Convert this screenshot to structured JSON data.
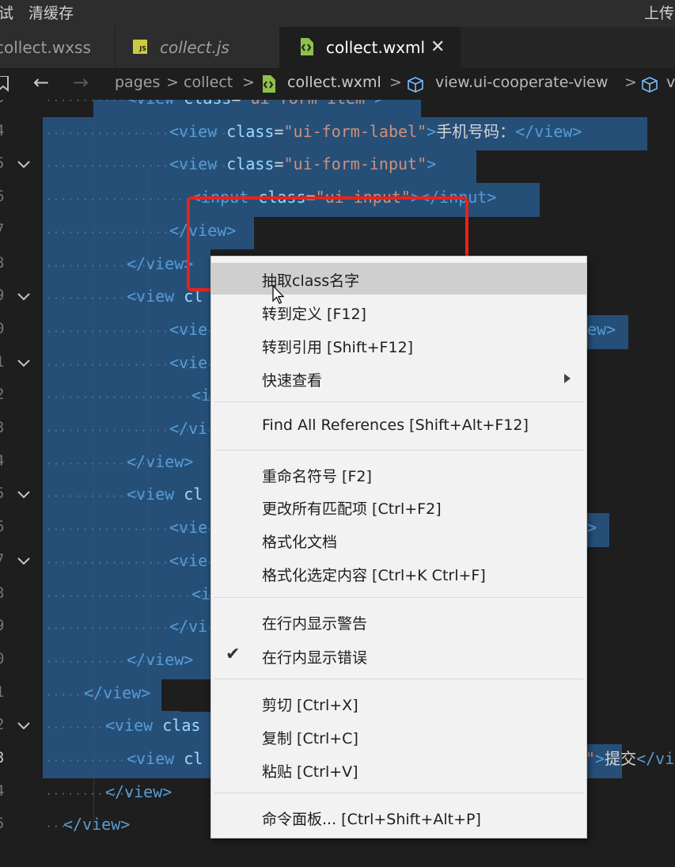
{
  "topbar": {
    "left_items": [
      "试",
      "清缓存"
    ],
    "right_item": "上传"
  },
  "tabs": [
    {
      "label": "collect.wxss"
    },
    {
      "label": "collect.js",
      "badge": "JS"
    },
    {
      "label": "collect.wxml",
      "close": "✕"
    }
  ],
  "breadcrumbs": {
    "items": [
      "pages",
      "collect",
      "collect.wxml",
      "view.ui-cooperate-view",
      "v"
    ],
    "separator": ">"
  },
  "gutter": {
    "line_numbers": [
      "3",
      "4",
      "5",
      "6",
      "7",
      "8",
      "9",
      "0",
      "1",
      "2",
      "3",
      "4",
      "5",
      "6",
      "7",
      "8",
      "9",
      "0",
      "1",
      "2",
      "3",
      "4",
      "5"
    ],
    "current_line": "3"
  },
  "code": [
    {
      "parts": [
        [
          "t",
          "<view "
        ],
        [
          "a",
          "class"
        ],
        [
          "x",
          "="
        ],
        [
          "s",
          "\"ui-form-item\""
        ],
        [
          "t",
          ">"
        ]
      ]
    },
    {
      "parts": [
        [
          "t",
          "<view "
        ],
        [
          "a",
          "class"
        ],
        [
          "x",
          "="
        ],
        [
          "s",
          "\"ui-form-label\""
        ],
        [
          "t",
          ">"
        ],
        [
          "x",
          "手机号码："
        ],
        [
          "t",
          "</view>"
        ]
      ]
    },
    {
      "parts": [
        [
          "t",
          "<view "
        ],
        [
          "a",
          "class"
        ],
        [
          "x",
          "="
        ],
        [
          "s",
          "\"ui-form-input\""
        ],
        [
          "t",
          ">"
        ]
      ]
    },
    {
      "parts": [
        [
          "t",
          "<input "
        ],
        [
          "a",
          "class"
        ],
        [
          "x",
          "="
        ],
        [
          "s",
          "\"ui-input\""
        ],
        [
          "t",
          "></input>"
        ]
      ]
    },
    {
      "parts": [
        [
          "t",
          "</view>"
        ]
      ]
    },
    {
      "parts": [
        [
          "t",
          "</view>"
        ]
      ]
    },
    {
      "parts": [
        [
          "t",
          "<view "
        ],
        [
          "a",
          "cl"
        ]
      ]
    },
    {
      "parts": [
        [
          "t",
          "<vie"
        ]
      ],
      "tail": [
        [
          "t",
          "ew>"
        ]
      ]
    },
    {
      "parts": [
        [
          "t",
          "<vie"
        ]
      ]
    },
    {
      "parts": [
        [
          "t",
          "<i"
        ]
      ]
    },
    {
      "parts": [
        [
          "t",
          "</vi"
        ]
      ]
    },
    {
      "parts": [
        [
          "t",
          "</view>"
        ]
      ]
    },
    {
      "parts": [
        [
          "t",
          "<view "
        ],
        [
          "a",
          "cl"
        ]
      ]
    },
    {
      "parts": [
        [
          "t",
          "<vie"
        ]
      ],
      "tail": [
        [
          "t",
          ">"
        ]
      ]
    },
    {
      "parts": [
        [
          "t",
          "<vie"
        ]
      ]
    },
    {
      "parts": [
        [
          "t",
          "<i"
        ]
      ]
    },
    {
      "parts": [
        [
          "t",
          "</vi"
        ]
      ]
    },
    {
      "parts": [
        [
          "t",
          "</view>"
        ]
      ]
    },
    {
      "parts": [
        [
          "t",
          "</view>"
        ]
      ]
    },
    {
      "parts": [
        [
          "t",
          "<view "
        ],
        [
          "a",
          "clas"
        ]
      ]
    },
    {
      "parts": [
        [
          "t",
          "<view "
        ],
        [
          "a",
          "cl"
        ]
      ],
      "tail": [
        [
          "s",
          "\""
        ],
        [
          "t",
          ">"
        ],
        [
          "x",
          "提交"
        ],
        [
          "t",
          "</vi"
        ]
      ]
    },
    {
      "parts": [
        [
          "t",
          "</view>"
        ]
      ]
    },
    {
      "parts": [
        [
          "t",
          "</view>"
        ]
      ]
    }
  ],
  "context_menu": {
    "items": [
      {
        "label": "抽取class名字",
        "highlighted": true
      },
      {
        "label": "转到定义  [F12]"
      },
      {
        "label": "转到引用  [Shift+F12]"
      },
      {
        "label": "快速查看",
        "submenu": true
      },
      {
        "separator": true
      },
      {
        "label": "Find All References  [Shift+Alt+F12]"
      },
      {
        "separator": true
      },
      {
        "label": "重命名符号  [F2]"
      },
      {
        "label": "更改所有匹配项  [Ctrl+F2]"
      },
      {
        "label": "格式化文档"
      },
      {
        "label": "格式化选定内容  [Ctrl+K Ctrl+F]"
      },
      {
        "separator": true
      },
      {
        "label": "在行内显示警告"
      },
      {
        "label": "在行内显示错误",
        "checked": true
      },
      {
        "separator": true
      },
      {
        "label": "剪切  [Ctrl+X]"
      },
      {
        "label": "复制  [Ctrl+C]"
      },
      {
        "label": "粘贴  [Ctrl+V]"
      },
      {
        "separator": true
      },
      {
        "label": "命令面板...  [Ctrl+Shift+Alt+P]"
      }
    ]
  },
  "colors": {
    "editor_bg": "#1e1e1e",
    "selection": "#264f78",
    "tag": "#569cd6",
    "attr": "#9cdcfe",
    "string": "#ce9178",
    "menu_bg": "#f2f2f2",
    "menu_highlight": "#cfcfcf",
    "annotation_red": "#e8231b"
  }
}
